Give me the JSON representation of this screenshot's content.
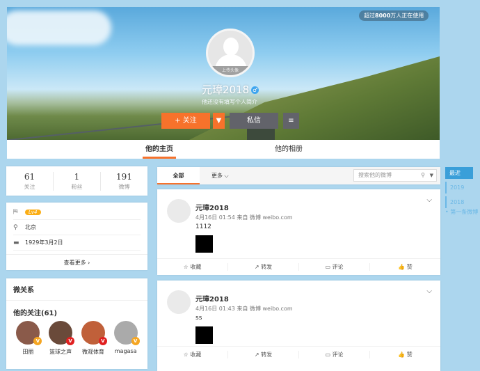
{
  "banner": {
    "users_badge_pre": "超过",
    "users_badge_num": "8000",
    "users_badge_post": "万人正在使用",
    "upload_avatar": "上传头像",
    "username": "元璋2018",
    "gender": "♂",
    "bio": "他还没有填写个人简介",
    "follow": "+ 关注",
    "message": "私信"
  },
  "tabs": [
    "他的主页",
    "他的相册"
  ],
  "stats": [
    {
      "n": "61",
      "l": "关注"
    },
    {
      "n": "1",
      "l": "粉丝"
    },
    {
      "n": "191",
      "l": "微博"
    }
  ],
  "info": {
    "level": "Lv4",
    "location": "北京",
    "birthday": "1929年3月2日",
    "see_more": "查看更多 ›"
  },
  "relations": {
    "title": "微关系",
    "following_title": "他的关注(61)",
    "following": [
      {
        "name": "田丽",
        "color": "#8a5a4a",
        "badge": "#f5a623"
      },
      {
        "name": "篮球之声",
        "color": "#6a4a3a",
        "badge": "#e02020"
      },
      {
        "name": "微观体育",
        "color": "#c0603a",
        "badge": "#e02020"
      },
      {
        "name": "magasa",
        "color": "#aaaaaa",
        "badge": "#f5a623"
      }
    ]
  },
  "feed": {
    "tab_all": "全部",
    "tab_more": "更多 ⌵",
    "search_placeholder": "搜索他的微博"
  },
  "posts": [
    {
      "name": "元璋2018",
      "meta": "4月16日 01:54 来自 微博 weibo.com",
      "text": "1112"
    },
    {
      "name": "元璋2018",
      "meta": "4月16日 01:43 来自 微博 weibo.com",
      "text": "ss"
    }
  ],
  "actions": [
    "☆ 收藏",
    "↗ 转发",
    "▭ 评论",
    "👍 赞"
  ],
  "timeline": {
    "recent": "最近",
    "years": [
      "2019",
      "2018"
    ],
    "first": "• 第一条微博"
  }
}
